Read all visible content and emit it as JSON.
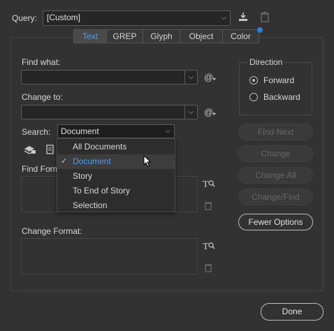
{
  "query": {
    "label": "Query:",
    "value": "[Custom]"
  },
  "tabs": [
    {
      "label": "Text",
      "active": true
    },
    {
      "label": "GREP",
      "active": false
    },
    {
      "label": "Glyph",
      "active": false
    },
    {
      "label": "Object",
      "active": false
    },
    {
      "label": "Color",
      "active": false
    }
  ],
  "find": {
    "label": "Find what:",
    "value": ""
  },
  "change": {
    "label": "Change to:",
    "value": ""
  },
  "search": {
    "label": "Search:",
    "value": "Document",
    "options": [
      "All Documents",
      "Document",
      "Story",
      "To End of Story",
      "Selection"
    ],
    "selected_index": 1
  },
  "find_format": {
    "label": "Find Forma"
  },
  "change_format": {
    "label": "Change Format:"
  },
  "direction": {
    "title": "Direction",
    "options": [
      {
        "label": "Forward",
        "checked": true
      },
      {
        "label": "Backward",
        "checked": false
      }
    ]
  },
  "buttons": {
    "find_next": "Find Next",
    "change": "Change",
    "change_all": "Change All",
    "change_find": "Change/Find",
    "fewer_options": "Fewer Options",
    "done": "Done"
  },
  "icons": {
    "at_symbol": "@",
    "save_query": "save-query-icon",
    "delete_query": "trash-icon",
    "at_find": "special-characters-icon",
    "at_change": "special-characters-icon"
  },
  "colors": {
    "accent": "#4a9cf0",
    "badge": "#2f7fe0"
  }
}
